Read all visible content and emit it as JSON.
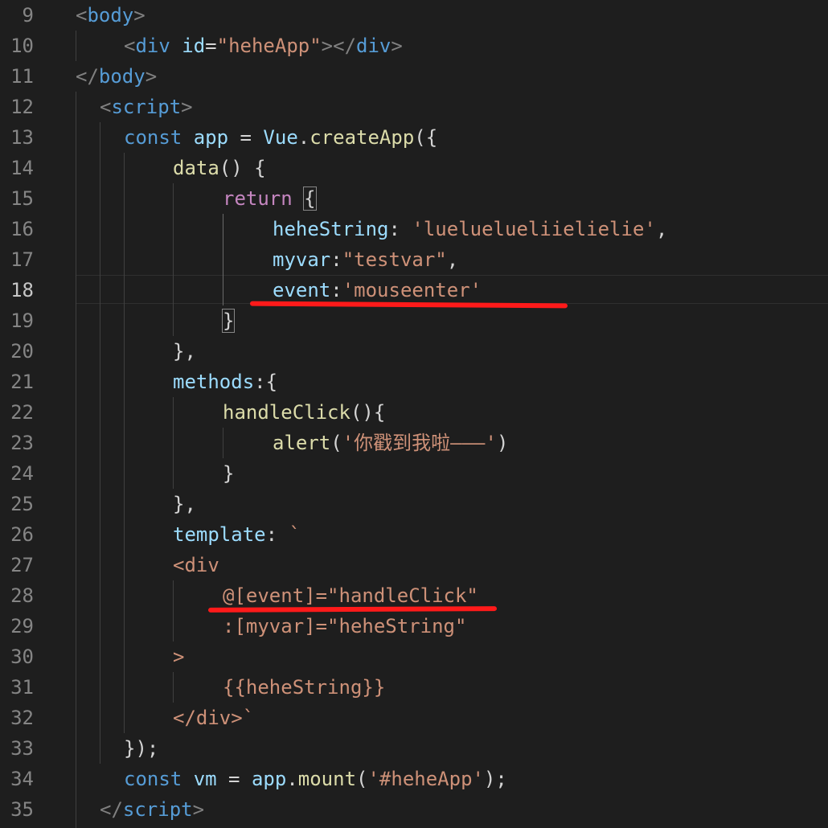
{
  "editor": {
    "active_line": 18,
    "lines": [
      {
        "n": 9,
        "indent": 94,
        "tokens": [
          {
            "t": "<",
            "c": "punct"
          },
          {
            "t": "body",
            "c": "tag"
          },
          {
            "t": ">",
            "c": "punct"
          }
        ]
      },
      {
        "n": 10,
        "indent": 154,
        "tokens": [
          {
            "t": "<",
            "c": "punct"
          },
          {
            "t": "div",
            "c": "tag"
          },
          {
            "t": " ",
            "c": "txt"
          },
          {
            "t": "id",
            "c": "attr"
          },
          {
            "t": "=",
            "c": "txt"
          },
          {
            "t": "\"heheApp\"",
            "c": "str"
          },
          {
            "t": "></",
            "c": "punct"
          },
          {
            "t": "div",
            "c": "tag"
          },
          {
            "t": ">",
            "c": "punct"
          }
        ]
      },
      {
        "n": 11,
        "indent": 94,
        "tokens": [
          {
            "t": "</",
            "c": "punct"
          },
          {
            "t": "body",
            "c": "tag"
          },
          {
            "t": ">",
            "c": "punct"
          }
        ]
      },
      {
        "n": 12,
        "indent": 124,
        "tokens": [
          {
            "t": "<",
            "c": "punct"
          },
          {
            "t": "script",
            "c": "tag"
          },
          {
            "t": ">",
            "c": "punct"
          }
        ]
      },
      {
        "n": 13,
        "indent": 154,
        "tokens": [
          {
            "t": "const",
            "c": "kw"
          },
          {
            "t": " ",
            "c": "txt"
          },
          {
            "t": "app",
            "c": "var"
          },
          {
            "t": " = ",
            "c": "txt"
          },
          {
            "t": "Vue",
            "c": "var"
          },
          {
            "t": ".",
            "c": "txt"
          },
          {
            "t": "createApp",
            "c": "fn"
          },
          {
            "t": "({",
            "c": "txt"
          }
        ]
      },
      {
        "n": 14,
        "indent": 215,
        "tokens": [
          {
            "t": "data",
            "c": "fn"
          },
          {
            "t": "() {",
            "c": "txt"
          }
        ]
      },
      {
        "n": 15,
        "indent": 277,
        "tokens": [
          {
            "t": "return",
            "c": "ctl"
          },
          {
            "t": " ",
            "c": "txt"
          },
          {
            "t": "{",
            "c": "txt",
            "box": true
          }
        ]
      },
      {
        "n": 16,
        "indent": 339,
        "tokens": [
          {
            "t": "heheString",
            "c": "prop"
          },
          {
            "t": ": ",
            "c": "txt"
          },
          {
            "t": "'lueluelueliielielie'",
            "c": "str"
          },
          {
            "t": ",",
            "c": "txt"
          }
        ]
      },
      {
        "n": 17,
        "indent": 339,
        "tokens": [
          {
            "t": "myvar",
            "c": "prop"
          },
          {
            "t": ":",
            "c": "txt"
          },
          {
            "t": "\"testvar\"",
            "c": "str"
          },
          {
            "t": ",",
            "c": "txt"
          }
        ]
      },
      {
        "n": 18,
        "indent": 339,
        "tokens": [
          {
            "t": "event",
            "c": "prop"
          },
          {
            "t": ":",
            "c": "txt"
          },
          {
            "t": "'mouseenter'",
            "c": "str"
          }
        ]
      },
      {
        "n": 19,
        "indent": 277,
        "tokens": [
          {
            "t": "}",
            "c": "txt",
            "box": true
          }
        ]
      },
      {
        "n": 20,
        "indent": 215,
        "tokens": [
          {
            "t": "},",
            "c": "txt"
          }
        ]
      },
      {
        "n": 21,
        "indent": 215,
        "tokens": [
          {
            "t": "methods",
            "c": "prop"
          },
          {
            "t": ":{",
            "c": "txt"
          }
        ]
      },
      {
        "n": 22,
        "indent": 277,
        "tokens": [
          {
            "t": "handleClick",
            "c": "fn"
          },
          {
            "t": "(){",
            "c": "txt"
          }
        ]
      },
      {
        "n": 23,
        "indent": 339,
        "tokens": [
          {
            "t": "alert",
            "c": "fn"
          },
          {
            "t": "(",
            "c": "txt"
          },
          {
            "t": "'你戳到我啦———'",
            "c": "str"
          },
          {
            "t": ")",
            "c": "txt"
          }
        ]
      },
      {
        "n": 24,
        "indent": 277,
        "tokens": [
          {
            "t": "}",
            "c": "txt"
          }
        ]
      },
      {
        "n": 25,
        "indent": 215,
        "tokens": [
          {
            "t": "},",
            "c": "txt"
          }
        ]
      },
      {
        "n": 26,
        "indent": 215,
        "tokens": [
          {
            "t": "template",
            "c": "prop"
          },
          {
            "t": ": ",
            "c": "txt"
          },
          {
            "t": "`",
            "c": "str"
          }
        ]
      },
      {
        "n": 27,
        "indent": 215,
        "tokens": [
          {
            "t": "<div",
            "c": "str"
          }
        ]
      },
      {
        "n": 28,
        "indent": 277,
        "tokens": [
          {
            "t": "@[event]=\"handleClick\"",
            "c": "str"
          }
        ]
      },
      {
        "n": 29,
        "indent": 277,
        "tokens": [
          {
            "t": ":[myvar]=\"heheString\"",
            "c": "str"
          }
        ]
      },
      {
        "n": 30,
        "indent": 215,
        "tokens": [
          {
            "t": ">",
            "c": "str"
          }
        ]
      },
      {
        "n": 31,
        "indent": 277,
        "tokens": [
          {
            "t": "{{heheString}}",
            "c": "str"
          }
        ]
      },
      {
        "n": 32,
        "indent": 215,
        "tokens": [
          {
            "t": "</div>`",
            "c": "str"
          }
        ]
      },
      {
        "n": 33,
        "indent": 154,
        "tokens": [
          {
            "t": "});",
            "c": "txt"
          }
        ]
      },
      {
        "n": 34,
        "indent": 154,
        "tokens": [
          {
            "t": "const",
            "c": "kw"
          },
          {
            "t": " ",
            "c": "txt"
          },
          {
            "t": "vm",
            "c": "var"
          },
          {
            "t": " = ",
            "c": "txt"
          },
          {
            "t": "app",
            "c": "var"
          },
          {
            "t": ".",
            "c": "txt"
          },
          {
            "t": "mount",
            "c": "fn"
          },
          {
            "t": "(",
            "c": "txt"
          },
          {
            "t": "'#heheApp'",
            "c": "str"
          },
          {
            "t": ");",
            "c": "txt"
          }
        ]
      },
      {
        "n": 35,
        "indent": 124,
        "tokens": [
          {
            "t": "</",
            "c": "punct"
          },
          {
            "t": "script",
            "c": "tag"
          },
          {
            "t": ">",
            "c": "punct"
          }
        ]
      }
    ]
  },
  "colors": {
    "background": "#1e1e1e",
    "annotation": "#ff1a1a"
  }
}
